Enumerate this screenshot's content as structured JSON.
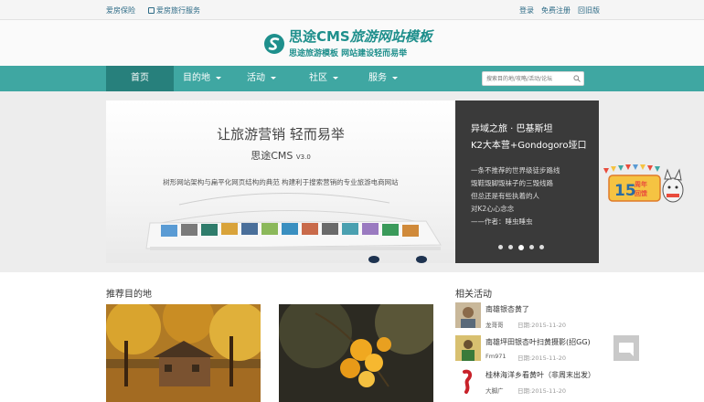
{
  "topbar": {
    "left_links": [
      "爱房保险",
      "爱房旅行服务"
    ],
    "right_links": [
      "登录",
      "免费注册",
      "回旧版"
    ]
  },
  "header": {
    "logo_brand": "思途CMS",
    "logo_suffix": "旅游网站模板",
    "slogan": "思途旅游模板  网站建设轻而易举",
    "logo_color": "#1e8f8c"
  },
  "nav": {
    "items": [
      {
        "label": "首页",
        "active": true,
        "dropdown": false
      },
      {
        "label": "目的地",
        "active": false,
        "dropdown": true
      },
      {
        "label": "活动",
        "active": false,
        "dropdown": true
      },
      {
        "label": "社区",
        "active": false,
        "dropdown": true
      },
      {
        "label": "服务",
        "active": false,
        "dropdown": true
      }
    ],
    "search_placeholder": "搜索目的地/攻略/活动/论坛",
    "bar_color": "#3fa7a2",
    "active_color": "#27807c"
  },
  "banner": {
    "headline": "让旅游营销 轻而易举",
    "product": "思途CMS",
    "version": "V3.0",
    "tagline": "树形网站架构与扁平化网页结构的典范    构建利于搜索营销的专业旅游电商网站",
    "caption": {
      "title_line1": "异域之旅 · 巴基斯坦",
      "title_line2": "K2大本营+Gondogoro垭口",
      "lines": [
        "一条不推荐的世界级徒步路线",
        "毁鞋毁脚毁袜子的三毁线路",
        "但总还是有些执着的人",
        "对K2心心念念",
        "——作者：睡虫睡虫"
      ]
    },
    "slide_count": 5,
    "active_slide": 3
  },
  "side_ad": {
    "number": "15",
    "text": "周年 回馈"
  },
  "destinations": {
    "title": "推荐目的地"
  },
  "activities": {
    "title": "相关活动",
    "items": [
      {
        "title": "南雄银杏黄了",
        "user": "龙哥哥",
        "date": "日期:2015-11-20"
      },
      {
        "title": "南雄坪田银杏叶扫黄摄影(招GG)",
        "user": "Fm971",
        "date": "日期:2015-11-20"
      },
      {
        "title": "桂林海洋乡看黄叶（非周末出发）",
        "user": "大脚广",
        "date": "日期:2015-11-20"
      }
    ]
  }
}
